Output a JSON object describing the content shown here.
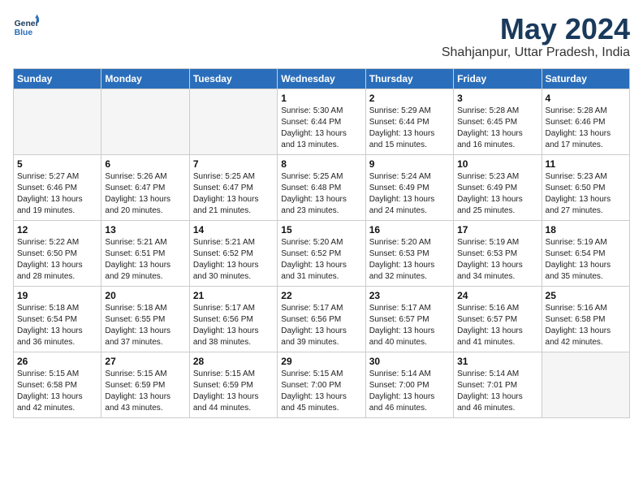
{
  "header": {
    "logo_line1": "General",
    "logo_line2": "Blue",
    "month_year": "May 2024",
    "location": "Shahjanpur, Uttar Pradesh, India"
  },
  "weekdays": [
    "Sunday",
    "Monday",
    "Tuesday",
    "Wednesday",
    "Thursday",
    "Friday",
    "Saturday"
  ],
  "weeks": [
    [
      {
        "day": "",
        "detail": ""
      },
      {
        "day": "",
        "detail": ""
      },
      {
        "day": "",
        "detail": ""
      },
      {
        "day": "1",
        "detail": "Sunrise: 5:30 AM\nSunset: 6:44 PM\nDaylight: 13 hours\nand 13 minutes."
      },
      {
        "day": "2",
        "detail": "Sunrise: 5:29 AM\nSunset: 6:44 PM\nDaylight: 13 hours\nand 15 minutes."
      },
      {
        "day": "3",
        "detail": "Sunrise: 5:28 AM\nSunset: 6:45 PM\nDaylight: 13 hours\nand 16 minutes."
      },
      {
        "day": "4",
        "detail": "Sunrise: 5:28 AM\nSunset: 6:46 PM\nDaylight: 13 hours\nand 17 minutes."
      }
    ],
    [
      {
        "day": "5",
        "detail": "Sunrise: 5:27 AM\nSunset: 6:46 PM\nDaylight: 13 hours\nand 19 minutes."
      },
      {
        "day": "6",
        "detail": "Sunrise: 5:26 AM\nSunset: 6:47 PM\nDaylight: 13 hours\nand 20 minutes."
      },
      {
        "day": "7",
        "detail": "Sunrise: 5:25 AM\nSunset: 6:47 PM\nDaylight: 13 hours\nand 21 minutes."
      },
      {
        "day": "8",
        "detail": "Sunrise: 5:25 AM\nSunset: 6:48 PM\nDaylight: 13 hours\nand 23 minutes."
      },
      {
        "day": "9",
        "detail": "Sunrise: 5:24 AM\nSunset: 6:49 PM\nDaylight: 13 hours\nand 24 minutes."
      },
      {
        "day": "10",
        "detail": "Sunrise: 5:23 AM\nSunset: 6:49 PM\nDaylight: 13 hours\nand 25 minutes."
      },
      {
        "day": "11",
        "detail": "Sunrise: 5:23 AM\nSunset: 6:50 PM\nDaylight: 13 hours\nand 27 minutes."
      }
    ],
    [
      {
        "day": "12",
        "detail": "Sunrise: 5:22 AM\nSunset: 6:50 PM\nDaylight: 13 hours\nand 28 minutes."
      },
      {
        "day": "13",
        "detail": "Sunrise: 5:21 AM\nSunset: 6:51 PM\nDaylight: 13 hours\nand 29 minutes."
      },
      {
        "day": "14",
        "detail": "Sunrise: 5:21 AM\nSunset: 6:52 PM\nDaylight: 13 hours\nand 30 minutes."
      },
      {
        "day": "15",
        "detail": "Sunrise: 5:20 AM\nSunset: 6:52 PM\nDaylight: 13 hours\nand 31 minutes."
      },
      {
        "day": "16",
        "detail": "Sunrise: 5:20 AM\nSunset: 6:53 PM\nDaylight: 13 hours\nand 32 minutes."
      },
      {
        "day": "17",
        "detail": "Sunrise: 5:19 AM\nSunset: 6:53 PM\nDaylight: 13 hours\nand 34 minutes."
      },
      {
        "day": "18",
        "detail": "Sunrise: 5:19 AM\nSunset: 6:54 PM\nDaylight: 13 hours\nand 35 minutes."
      }
    ],
    [
      {
        "day": "19",
        "detail": "Sunrise: 5:18 AM\nSunset: 6:54 PM\nDaylight: 13 hours\nand 36 minutes."
      },
      {
        "day": "20",
        "detail": "Sunrise: 5:18 AM\nSunset: 6:55 PM\nDaylight: 13 hours\nand 37 minutes."
      },
      {
        "day": "21",
        "detail": "Sunrise: 5:17 AM\nSunset: 6:56 PM\nDaylight: 13 hours\nand 38 minutes."
      },
      {
        "day": "22",
        "detail": "Sunrise: 5:17 AM\nSunset: 6:56 PM\nDaylight: 13 hours\nand 39 minutes."
      },
      {
        "day": "23",
        "detail": "Sunrise: 5:17 AM\nSunset: 6:57 PM\nDaylight: 13 hours\nand 40 minutes."
      },
      {
        "day": "24",
        "detail": "Sunrise: 5:16 AM\nSunset: 6:57 PM\nDaylight: 13 hours\nand 41 minutes."
      },
      {
        "day": "25",
        "detail": "Sunrise: 5:16 AM\nSunset: 6:58 PM\nDaylight: 13 hours\nand 42 minutes."
      }
    ],
    [
      {
        "day": "26",
        "detail": "Sunrise: 5:15 AM\nSunset: 6:58 PM\nDaylight: 13 hours\nand 42 minutes."
      },
      {
        "day": "27",
        "detail": "Sunrise: 5:15 AM\nSunset: 6:59 PM\nDaylight: 13 hours\nand 43 minutes."
      },
      {
        "day": "28",
        "detail": "Sunrise: 5:15 AM\nSunset: 6:59 PM\nDaylight: 13 hours\nand 44 minutes."
      },
      {
        "day": "29",
        "detail": "Sunrise: 5:15 AM\nSunset: 7:00 PM\nDaylight: 13 hours\nand 45 minutes."
      },
      {
        "day": "30",
        "detail": "Sunrise: 5:14 AM\nSunset: 7:00 PM\nDaylight: 13 hours\nand 46 minutes."
      },
      {
        "day": "31",
        "detail": "Sunrise: 5:14 AM\nSunset: 7:01 PM\nDaylight: 13 hours\nand 46 minutes."
      },
      {
        "day": "",
        "detail": ""
      }
    ]
  ]
}
